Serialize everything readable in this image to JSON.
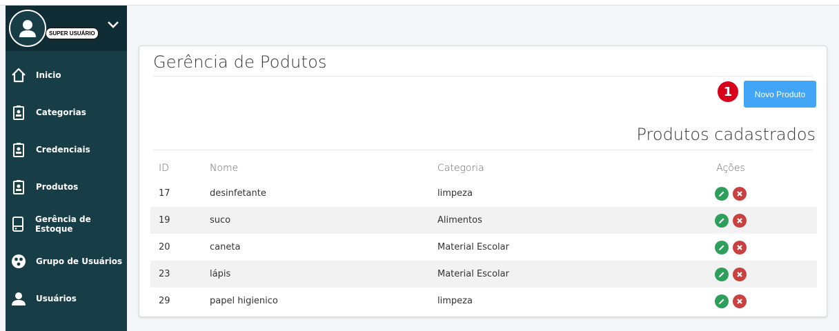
{
  "user": {
    "role": "SUPER USUÁRIO",
    "avatar_icon": "user-icon",
    "menu_icon": "chevron-down-icon"
  },
  "sidebar": {
    "items": [
      {
        "label": "Inicio",
        "icon": "home-icon"
      },
      {
        "label": "Categorias",
        "icon": "badge-icon"
      },
      {
        "label": "Credenciais",
        "icon": "badge-icon"
      },
      {
        "label": "Produtos",
        "icon": "badge-icon"
      },
      {
        "label": "Gerência de Estoque",
        "icon": "storage-icon"
      },
      {
        "label": "Grupo de Usuários",
        "icon": "group-icon"
      },
      {
        "label": "Usuários",
        "icon": "user-icon"
      }
    ]
  },
  "main": {
    "title": "Gerência de Podutos",
    "step_marker": "1",
    "new_button_label": "Novo Produto",
    "section_title": "Produtos cadastrados",
    "table": {
      "headers": [
        "ID",
        "Nome",
        "Categoria",
        "Ações"
      ],
      "rows": [
        {
          "id": "17",
          "nome": "desinfetante",
          "categoria": "limpeza"
        },
        {
          "id": "19",
          "nome": "suco",
          "categoria": "Alimentos"
        },
        {
          "id": "20",
          "nome": "caneta",
          "categoria": "Material Escolar"
        },
        {
          "id": "23",
          "nome": "lápis",
          "categoria": "Material Escolar"
        },
        {
          "id": "29",
          "nome": "papel higienico",
          "categoria": "limpeza"
        }
      ]
    }
  },
  "colors": {
    "sidebar_bg": "#173d47",
    "sidebar_header_bg": "#102d35",
    "primary_button": "#42a5f5",
    "step_badge": "#d9001b",
    "edit_action": "#2e9e5b",
    "delete_action": "#c94040"
  }
}
